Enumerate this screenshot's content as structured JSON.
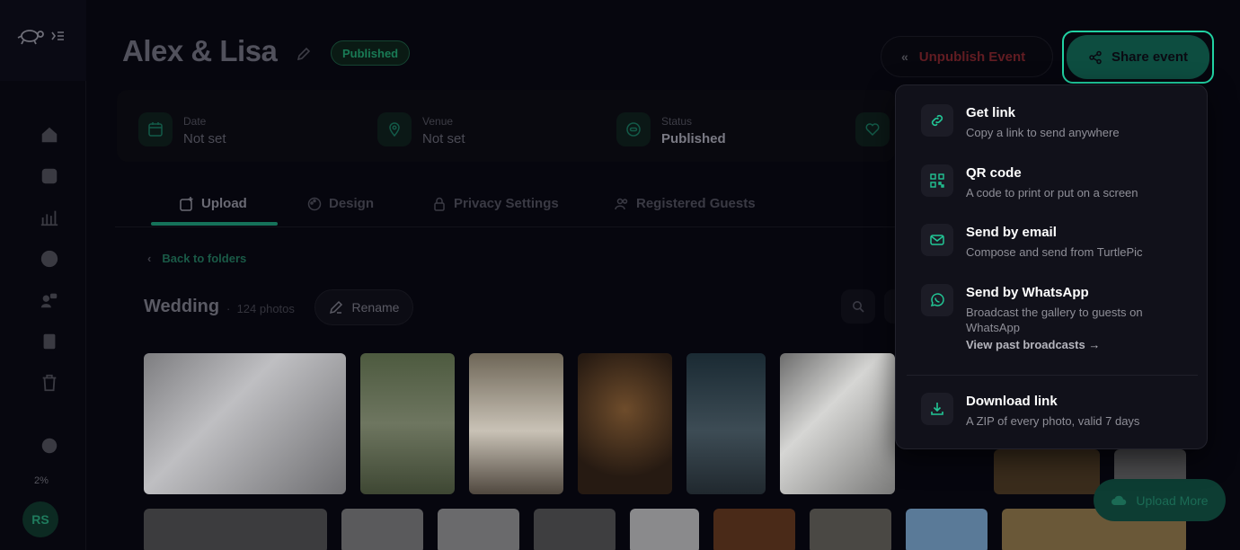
{
  "event": {
    "title": "Alex & Lisa",
    "status_badge": "Published"
  },
  "header": {
    "unpublish_label": "Unpublish Event",
    "share_label": "Share event"
  },
  "info": {
    "date_label": "Date",
    "date_value": "Not set",
    "venue_label": "Venue",
    "venue_value": "Not set",
    "status_label": "Status",
    "status_value": "Published"
  },
  "tabs": [
    {
      "label": "Upload"
    },
    {
      "label": "Design"
    },
    {
      "label": "Privacy Settings"
    },
    {
      "label": "Registered Guests"
    }
  ],
  "folder": {
    "back_label": "Back to folders",
    "name": "Wedding",
    "count": "124 photos",
    "rename_label": "Rename"
  },
  "sidebar": {
    "storage_pct": "2%",
    "avatar_initials": "RS"
  },
  "upload_more_label": "Upload More",
  "share_menu": {
    "items": [
      {
        "title": "Get link",
        "desc": "Copy a link to send anywhere",
        "icon": "link-icon"
      },
      {
        "title": "QR code",
        "desc": "A code to print or put on a screen",
        "icon": "qr-code-icon"
      },
      {
        "title": "Send by email",
        "desc": "Compose and send from TurtlePic",
        "icon": "mail-icon"
      },
      {
        "title": "Send by WhatsApp",
        "desc": "Broadcast the gallery to guests on WhatsApp",
        "link": "View past broadcasts →",
        "icon": "whatsapp-icon"
      },
      {
        "title": "Download link",
        "desc": "A ZIP of every photo, valid 7 days",
        "icon": "download-icon"
      }
    ]
  },
  "colors": {
    "accent": "#21d2a3",
    "background": "#06060e",
    "menu_bg": "#11111a"
  }
}
